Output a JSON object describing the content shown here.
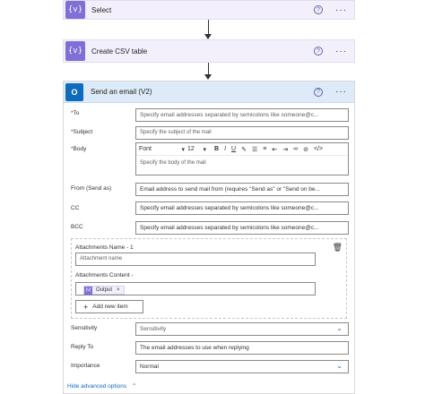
{
  "actions": {
    "select": {
      "title": "Select",
      "icon": "{v}"
    },
    "csv": {
      "title": "Create CSV table",
      "icon": "{v}"
    }
  },
  "email": {
    "title": "Send an email (V2)",
    "icon": "O",
    "fields": {
      "to": {
        "label": "To",
        "placeholder": "Specify email addresses separated by semicolons like someone@c..."
      },
      "subject": {
        "label": "Subject",
        "placeholder": "Specify the subject of the mail"
      },
      "body": {
        "label": "Body",
        "placeholder": "Specify the body of the mail",
        "font": "Font",
        "size": "12"
      },
      "from": {
        "label": "From (Send as)",
        "placeholder": "Email address to send mail from (requires \"Send as\" or \"Send on be..."
      },
      "cc": {
        "label": "CC",
        "placeholder": "Specify email addresses separated by semicolons like someone@c..."
      },
      "bcc": {
        "label": "BCC",
        "placeholder": "Specify email addresses separated by semicolons like someone@c..."
      }
    },
    "attachments": {
      "name_label": "Attachments Name - 1",
      "name_placeholder": "Attachment name",
      "content_label": "Attachments Content -",
      "token": "Output",
      "token_remove": "×",
      "add_label": "Add new item"
    },
    "sensitivity": {
      "label": "Sensitivity",
      "value": "Sensitivity"
    },
    "reply_to": {
      "label": "Reply To",
      "placeholder": "The email addresses to use when replying"
    },
    "importance": {
      "label": "Importance",
      "value": "Normal"
    },
    "advanced": "Hide advanced options"
  },
  "common": {
    "help": "?",
    "more": "···",
    "required": "*",
    "plus": "+"
  },
  "colors": {
    "operation": "#7f6fd6",
    "outlook": "#0f6cbd",
    "header": "#ddeaf7",
    "action_bg": "#f3f0fb"
  }
}
